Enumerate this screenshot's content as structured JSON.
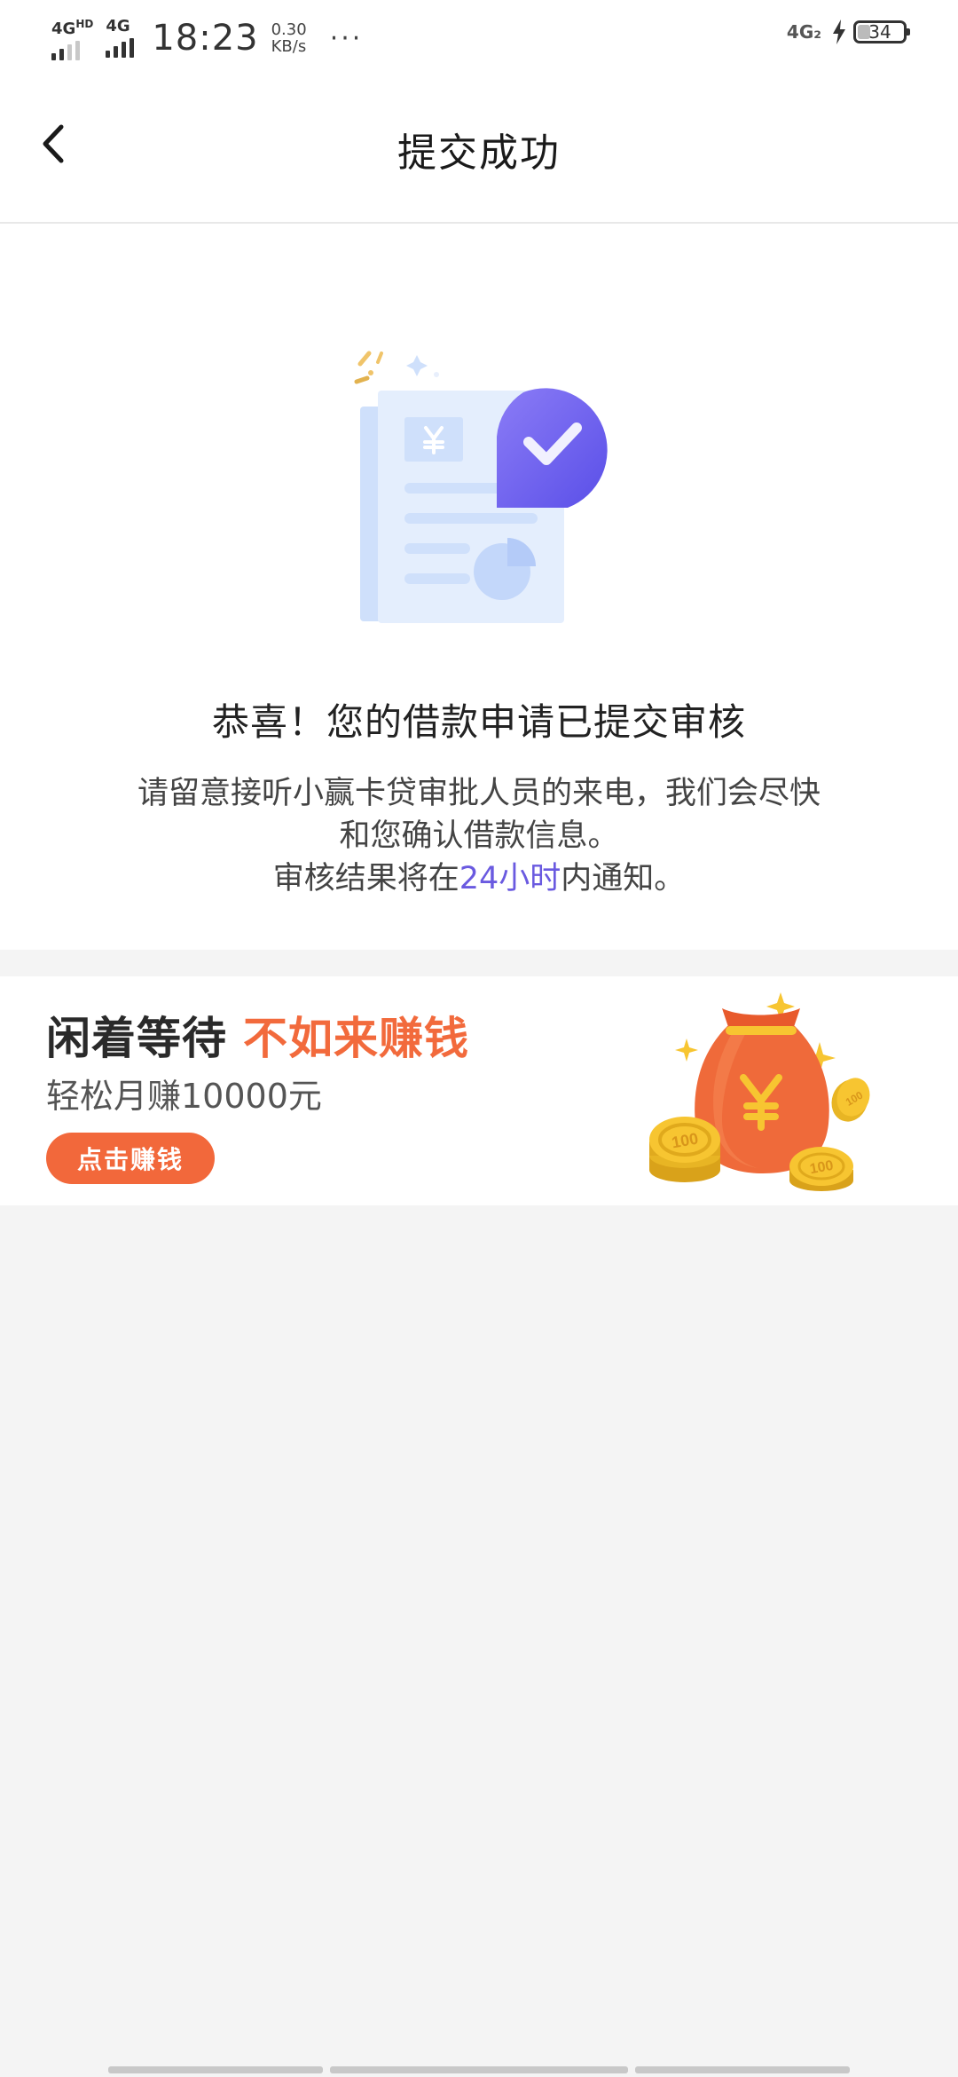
{
  "status_bar": {
    "network_1": "4G",
    "network_1_suffix": "HD",
    "network_2": "4G",
    "time": "18:23",
    "speed_value": "0.30",
    "speed_unit": "KB/s",
    "more": "···",
    "sim2_label": "4G₂",
    "battery_level": "34"
  },
  "header": {
    "title": "提交成功"
  },
  "success": {
    "title": "恭喜！您的借款申请已提交审核",
    "desc_line1": "请留意接听小赢卡贷审批人员的来电，我们会尽快",
    "desc_line2": "和您确认借款信息。",
    "desc_line3_prefix": "审核结果将在",
    "desc_line3_highlight": "24小时",
    "desc_line3_suffix": "内通知。"
  },
  "promo": {
    "title": "闲着等待",
    "title_accent": "不如来赚钱",
    "subtitle": "轻松月赚10000元",
    "button_label": "点击赚钱"
  },
  "colors": {
    "accent_purple": "#6a5ae0",
    "promo_orange": "#f2683b",
    "background": "#f4f4f4"
  },
  "icons": {
    "back": "chevron-left-icon",
    "illustration": "document-check-illustration",
    "promo": "money-bag-illustration"
  }
}
